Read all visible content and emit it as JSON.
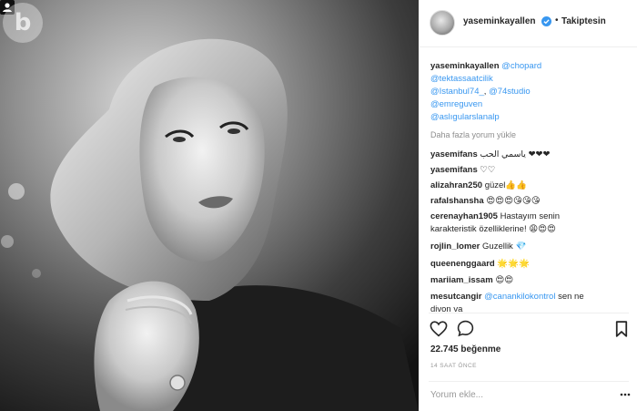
{
  "post": {
    "username": "yaseminkayallen",
    "follow_status": "Takiptesin",
    "separator": "•"
  },
  "caption": {
    "username": "yaseminkayallen",
    "mentions": [
      "@chopard",
      "@tektassaatcilik",
      "@Istanbul74_",
      "@74studio",
      "@emreguven",
      "@aslıgularslanalp"
    ]
  },
  "load_more": "Daha fazla yorum yükle",
  "comments": [
    {
      "user": "yasemifans",
      "text": "ياسمي الحب ❤❤❤"
    },
    {
      "user": "yasemifans",
      "text": "♡♡"
    },
    {
      "user": "alizahran250",
      "text": "güzel👍👍"
    },
    {
      "user": "rafalshansha",
      "text": "😍😍😍😘😘😘"
    },
    {
      "user": "cerenayhan1905",
      "text": "Hastayım senin",
      "text2": "karakteristik özelliklerine!",
      "emojis": "😩😍😍"
    },
    {
      "user": "rojlin_lomer",
      "text": "Guzellik 💎"
    },
    {
      "user": "queenenggaard",
      "text": "🌟🌟🌟"
    },
    {
      "user": "mariiam_issam",
      "text": "😍😍"
    },
    {
      "user": "mesutcangir",
      "mention": "@canankilokontrol",
      "text": "sen ne",
      "text2": "divon va"
    }
  ],
  "likes": {
    "count": "22.745",
    "label": "beğenme"
  },
  "timestamp": "14 SAAT ÖNCE",
  "comment_input": {
    "placeholder": "Yorum ekle..."
  },
  "icons": {
    "like": "heart-outline-icon",
    "comment": "speech-bubble-icon",
    "save": "bookmark-icon",
    "more": "more-dots-icon",
    "verified": "verified-badge-icon",
    "gallery": "user-tag-icon",
    "watermark": "watermark-logo"
  },
  "colors": {
    "link": "#3897f0",
    "verified": "#3897f0",
    "text": "#262626",
    "muted": "#8e8e8e"
  }
}
